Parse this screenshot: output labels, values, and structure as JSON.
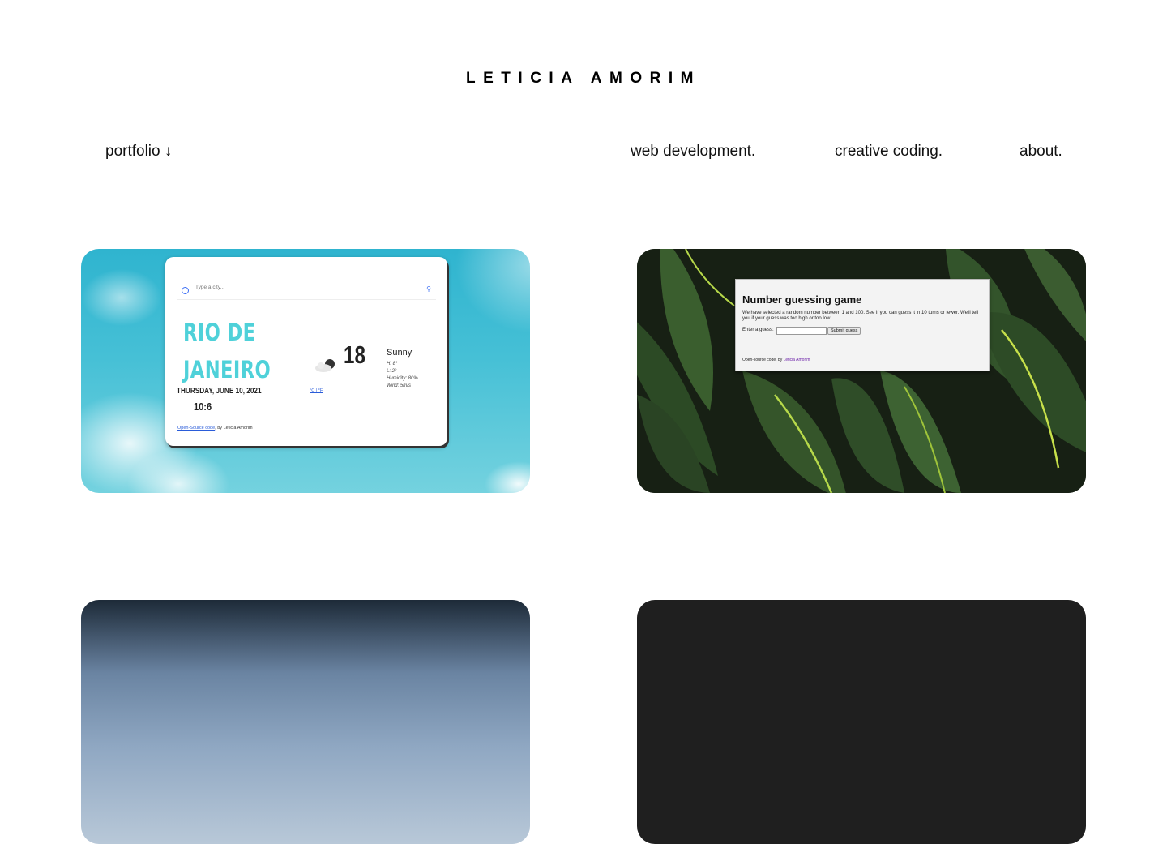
{
  "site": {
    "title": "LETICIA AMORIM"
  },
  "nav": {
    "portfolio_label": "portfolio ↓",
    "links": [
      "web development.",
      "creative coding.",
      "about."
    ]
  },
  "projects": [
    {
      "search_placeholder": "Type a city...",
      "city_line1": "RIO DE",
      "city_line2": "JANEIRO",
      "date": "THURSDAY, JUNE 10, 2021",
      "time": "10:6",
      "temperature": "18",
      "units": "°C | °F",
      "condition": "Sunny",
      "details": [
        "H: 8°",
        "L: 2°",
        "Humidity: 80%",
        "Wind: 5m/s"
      ],
      "footer_link": "Open-Source code",
      "footer_text": ", by Leticia Amorim"
    },
    {
      "title": "Number guessing game",
      "description": "We have selected a random number between 1 and 100. See if you can guess it in 10 turns or fewer. We'll tell you if your guess was too high or too low.",
      "input_label": "Enter a guess:",
      "button_label": "Submit guess",
      "footer_text": "Open-source code, by ",
      "footer_link": "Leticia Amorim"
    }
  ],
  "colors": {
    "accent_cyan": "#4fd1d9",
    "link_blue": "#2a5cd9",
    "link_purple": "#6b1fa8"
  }
}
